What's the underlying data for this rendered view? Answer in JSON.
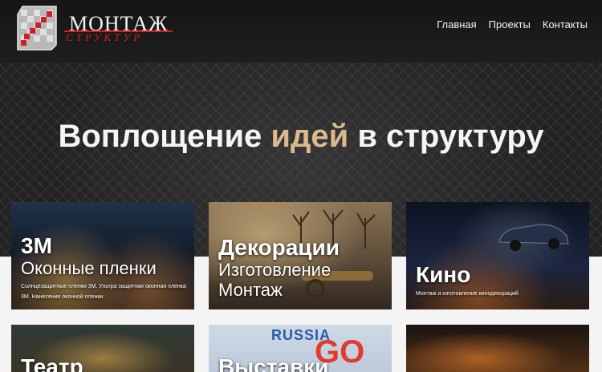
{
  "brand": {
    "name_top": "МОНТАЖ",
    "name_bottom": "СТРУКТУР",
    "logo_icon": "checkered-square-logo",
    "accent_color": "#d11f2a"
  },
  "nav": {
    "items": [
      {
        "label": "Главная"
      },
      {
        "label": "Проекты"
      },
      {
        "label": "Контакты"
      }
    ]
  },
  "hero": {
    "title_part1": "Воплощение ",
    "title_accent": "идей",
    "title_part2": " в структуру",
    "accent_color": "#d9b98d"
  },
  "cards": [
    {
      "title": "3M",
      "subtitle": "Оконные пленки",
      "description": "Солнцезащитные пленки 3M. Ультра защитная оконная пленка 3M. Нанесение оконной пленки."
    },
    {
      "title": "Декорации",
      "subtitle": "Изготовление",
      "subtitle2": "Монтаж"
    },
    {
      "title": "Кино",
      "description": "Монтаж и изготовление кинодекораций"
    },
    {
      "title": "Театр"
    },
    {
      "title": "Выставки",
      "image_text_1": "RUSSIA",
      "image_text_2": "GO"
    },
    {
      "title": ""
    }
  ]
}
